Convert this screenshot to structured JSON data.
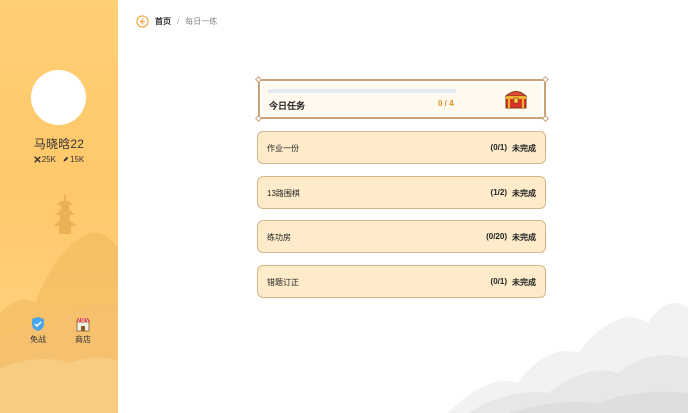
{
  "sidebar": {
    "username": "马晓晗22",
    "stats": [
      {
        "icon": "crossed-swords-icon",
        "value": "25K"
      },
      {
        "icon": "pencil-icon",
        "value": "15K"
      }
    ],
    "nav": [
      {
        "icon": "shield-icon",
        "label": "免战"
      },
      {
        "icon": "shop-icon",
        "label": "商店"
      }
    ]
  },
  "breadcrumb": {
    "home": "首页",
    "separator": "/",
    "current": "每日一练"
  },
  "today": {
    "title": "今日任务",
    "count": "0 / 4",
    "progress": 0
  },
  "tasks": [
    {
      "name": "作业一份",
      "progress": "(0/1)",
      "status": "未完成"
    },
    {
      "name": "13路围棋",
      "progress": "(1/2)",
      "status": "未完成"
    },
    {
      "name": "练功房",
      "progress": "(0/20)",
      "status": "未完成"
    },
    {
      "name": "错题订正",
      "progress": "(0/1)",
      "status": "未完成"
    }
  ],
  "colors": {
    "sidebar": "#ffc86a",
    "accent": "#e28b1b",
    "task_bg": "#fdebca",
    "task_border": "#d6b68a"
  }
}
